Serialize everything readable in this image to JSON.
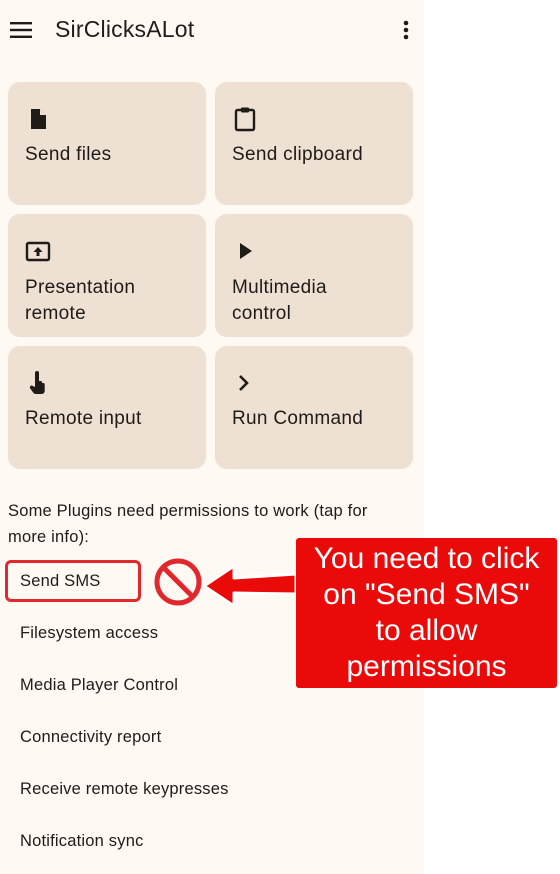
{
  "app": {
    "title": "SirClicksALot"
  },
  "cards": [
    {
      "label": "Send files",
      "icon": "file-icon"
    },
    {
      "label": "Send clipboard",
      "icon": "clipboard-icon"
    },
    {
      "label_line1": "Presentation",
      "label_line2": "remote",
      "icon": "presentation-icon"
    },
    {
      "label_line1": "Multimedia",
      "label_line2": "control",
      "icon": "play-icon"
    },
    {
      "label": "Remote input",
      "icon": "touch-icon"
    },
    {
      "label": "Run Command",
      "icon": "chevron-right-icon"
    }
  ],
  "permissions": {
    "note": "Some Plugins need permissions to work (tap for more info):",
    "items": [
      "Send SMS",
      "Filesystem access",
      "Media Player Control",
      "Connectivity report",
      "Receive remote keypresses",
      "Notification sync"
    ]
  },
  "annotation": {
    "line1": "You need to click",
    "line2": "on \"Send SMS\"",
    "line3": "to allow",
    "line4": "permissions",
    "color": "#ea0a0a"
  }
}
